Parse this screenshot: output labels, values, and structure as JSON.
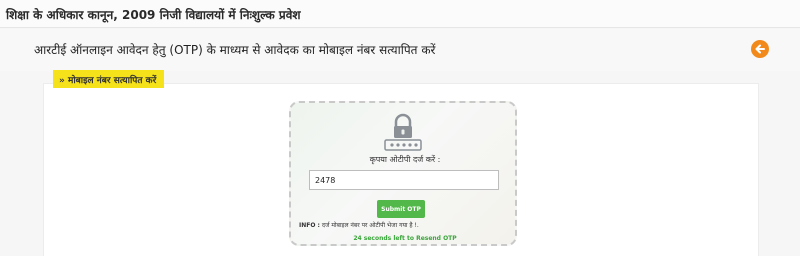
{
  "topbar": {
    "title": "शिक्षा के अधिकार कानून, 2009 निजी विद्यालयों में निःशुल्क प्रवेश"
  },
  "header": {
    "title": "आरटीई ऑनलाइन आवेदन हेतु (OTP) के माध्यम से आवेदक का मोबाइल नंबर सत्यापित करें",
    "back_icon": "arrow-left-circle-icon",
    "accent_color": "#f28a1b"
  },
  "section": {
    "tag_label": "» मोबाइल नंबर सत्यापित करें",
    "tag_color": "#f6e21a"
  },
  "otp_form": {
    "lock_icon": "password-lock-icon",
    "prompt": "कृपया ओटीपी दर्ज करें :",
    "otp_value": "2478",
    "submit_label": "Submit OTP",
    "submit_color": "#52b84a",
    "info_prefix": "INFO :",
    "info_text": "दर्ज मोबाइल नंबर पर ओटीपी भेजा गया है !.",
    "resend_timer": "24 seconds left to Resend OTP",
    "timer_color": "#3aa63a"
  }
}
